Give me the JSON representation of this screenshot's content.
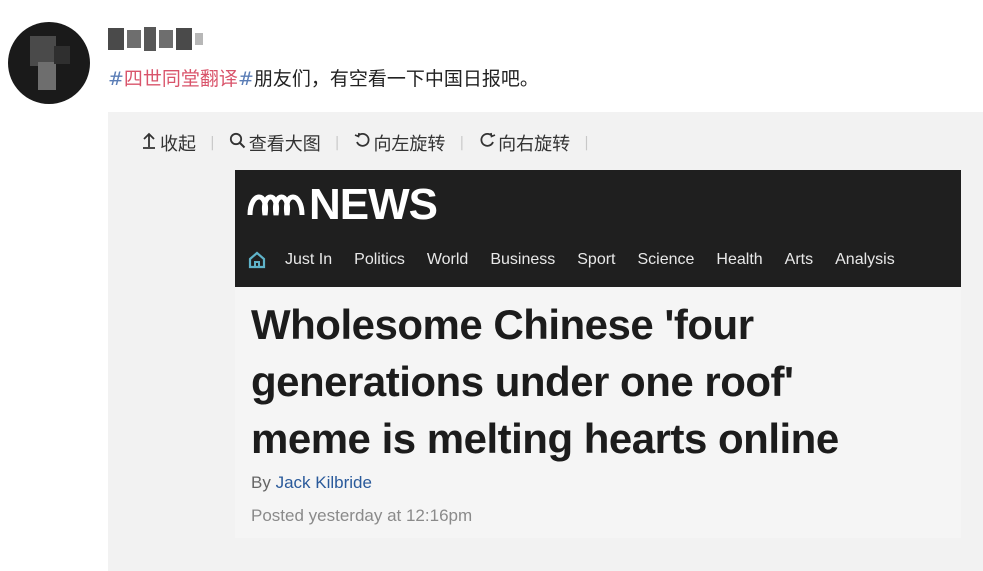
{
  "post": {
    "text_hashtag_open": "#",
    "text_hashtag": "四世同堂翻译",
    "text_hashtag_close": "#",
    "text_body": "朋友们，有空看一下中国日报吧。"
  },
  "toolbar": {
    "collapse_label": "收起",
    "collapse_icon": "↑",
    "view_large_label": "查看大图",
    "view_large_icon": "magnifier-icon",
    "rotate_left_label": "向左旋转",
    "rotate_right_label": "向右旋转",
    "separator": "|"
  },
  "article": {
    "logo_text": "NEWS",
    "nav": [
      "Just In",
      "Politics",
      "World",
      "Business",
      "Sport",
      "Science",
      "Health",
      "Arts",
      "Analysis"
    ],
    "headline_lines": [
      "Wholesome Chinese 'four",
      "generations under one roof'",
      "meme is melting hearts online"
    ],
    "by_prefix": "By ",
    "author": "Jack Kilbride",
    "posted": "Posted yesterday at 12:16pm"
  },
  "colors": {
    "hashtag": "#d9546b",
    "hash_mark": "#5a7db6",
    "abc_bar": "#1f1f1f",
    "home_icon": "#5fb3c9",
    "author_link": "#2a5a9b"
  }
}
